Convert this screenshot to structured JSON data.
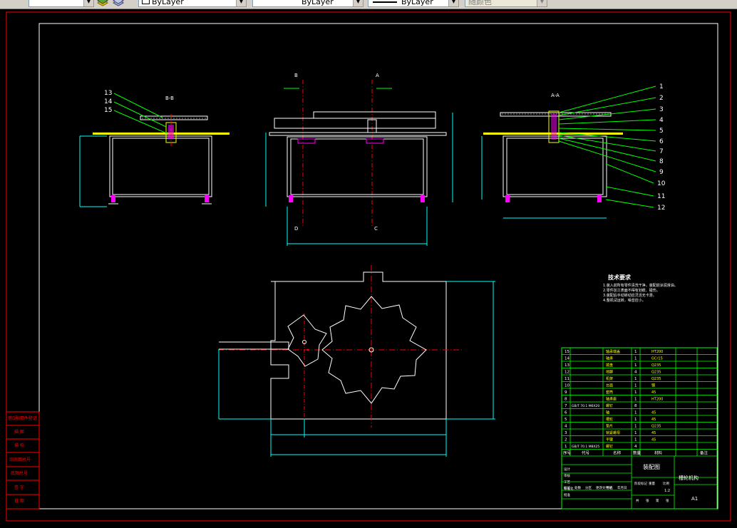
{
  "toolbar": {
    "color_control": "ByLayer",
    "linetype_control": "ByLayer",
    "lineweight_control": "ByLayer",
    "plotstyle_control": "随颜色"
  },
  "drawing": {
    "section_left": "B-B",
    "section_right": "A-A",
    "cut_b": "B",
    "cut_a": "A",
    "cut_d": "D",
    "cut_c": "C",
    "left_callouts": [
      "13",
      "14",
      "15"
    ],
    "right_callouts": [
      "1",
      "2",
      "3",
      "4",
      "5",
      "6",
      "7",
      "8",
      "9",
      "10",
      "11",
      "12"
    ],
    "tech_title": "技术要求",
    "tech_lines": [
      "1.装入前所有零件清洗干净，装配前涂润滑油。",
      "2.零件加工表面不得有划痕、碰伤。",
      "3.装配后手动转动应灵活无卡滞。",
      "4.整机试运转，噪音应小。"
    ]
  },
  "left_stamp": {
    "rows": [
      "借(通)用件登记",
      "描 图",
      "描 校",
      "旧底图总号",
      "底图总号",
      "签 字",
      "日 期"
    ]
  },
  "title_block": {
    "bom_rows": [
      {
        "no": "15",
        "code": "",
        "name": "轴承端盖",
        "qty": "1",
        "material": "HT200"
      },
      {
        "no": "14",
        "code": "",
        "name": "轴承",
        "qty": "1",
        "material": "GCr15"
      },
      {
        "no": "13",
        "code": "",
        "name": "拨盘",
        "qty": "1",
        "material": "Q235"
      },
      {
        "no": "12",
        "code": "",
        "name": "地脚",
        "qty": "4",
        "material": "Q235"
      },
      {
        "no": "11",
        "code": "",
        "name": "机架",
        "qty": "1",
        "material": "Q235"
      },
      {
        "no": "10",
        "code": "",
        "name": "台面",
        "qty": "1",
        "material": "钢"
      },
      {
        "no": "9",
        "code": "",
        "name": "套筒",
        "qty": "1",
        "material": "45"
      },
      {
        "no": "8",
        "code": "",
        "name": "轴承座",
        "qty": "1",
        "material": "HT200"
      },
      {
        "no": "7",
        "code": "GB/T 70.1 M6X20",
        "name": "螺钉",
        "qty": "8",
        "material": ""
      },
      {
        "no": "6",
        "code": "",
        "name": "轴",
        "qty": "1",
        "material": "45"
      },
      {
        "no": "5",
        "code": "",
        "name": "槽轮",
        "qty": "1",
        "material": "45"
      },
      {
        "no": "4",
        "code": "",
        "name": "垫片",
        "qty": "1",
        "material": "Q235"
      },
      {
        "no": "3",
        "code": "",
        "name": "锁紧螺母",
        "qty": "1",
        "material": "45"
      },
      {
        "no": "2",
        "code": "",
        "name": "平键",
        "qty": "1",
        "material": "45"
      },
      {
        "no": "1",
        "code": "GB/T 70.1 M8X25",
        "name": "螺钉",
        "qty": "4",
        "material": ""
      }
    ],
    "header": [
      "序号",
      "代号",
      "名称",
      "数量",
      "材料",
      "备注"
    ],
    "drawing_name": "装配图",
    "product_name": "槽轮机构",
    "sheet_size": "A1",
    "sign_labels": [
      "标记",
      "处数",
      "分区",
      "更改文件号",
      "签名",
      "年月日"
    ],
    "sign_labels2": [
      "设计",
      "审核",
      "工艺",
      "标准化",
      "批准"
    ],
    "stage_labels": [
      "阶段标记",
      "重量",
      "比例"
    ],
    "scale": "1:2",
    "sheet_labels": [
      "共",
      "张",
      "第",
      "张"
    ]
  }
}
